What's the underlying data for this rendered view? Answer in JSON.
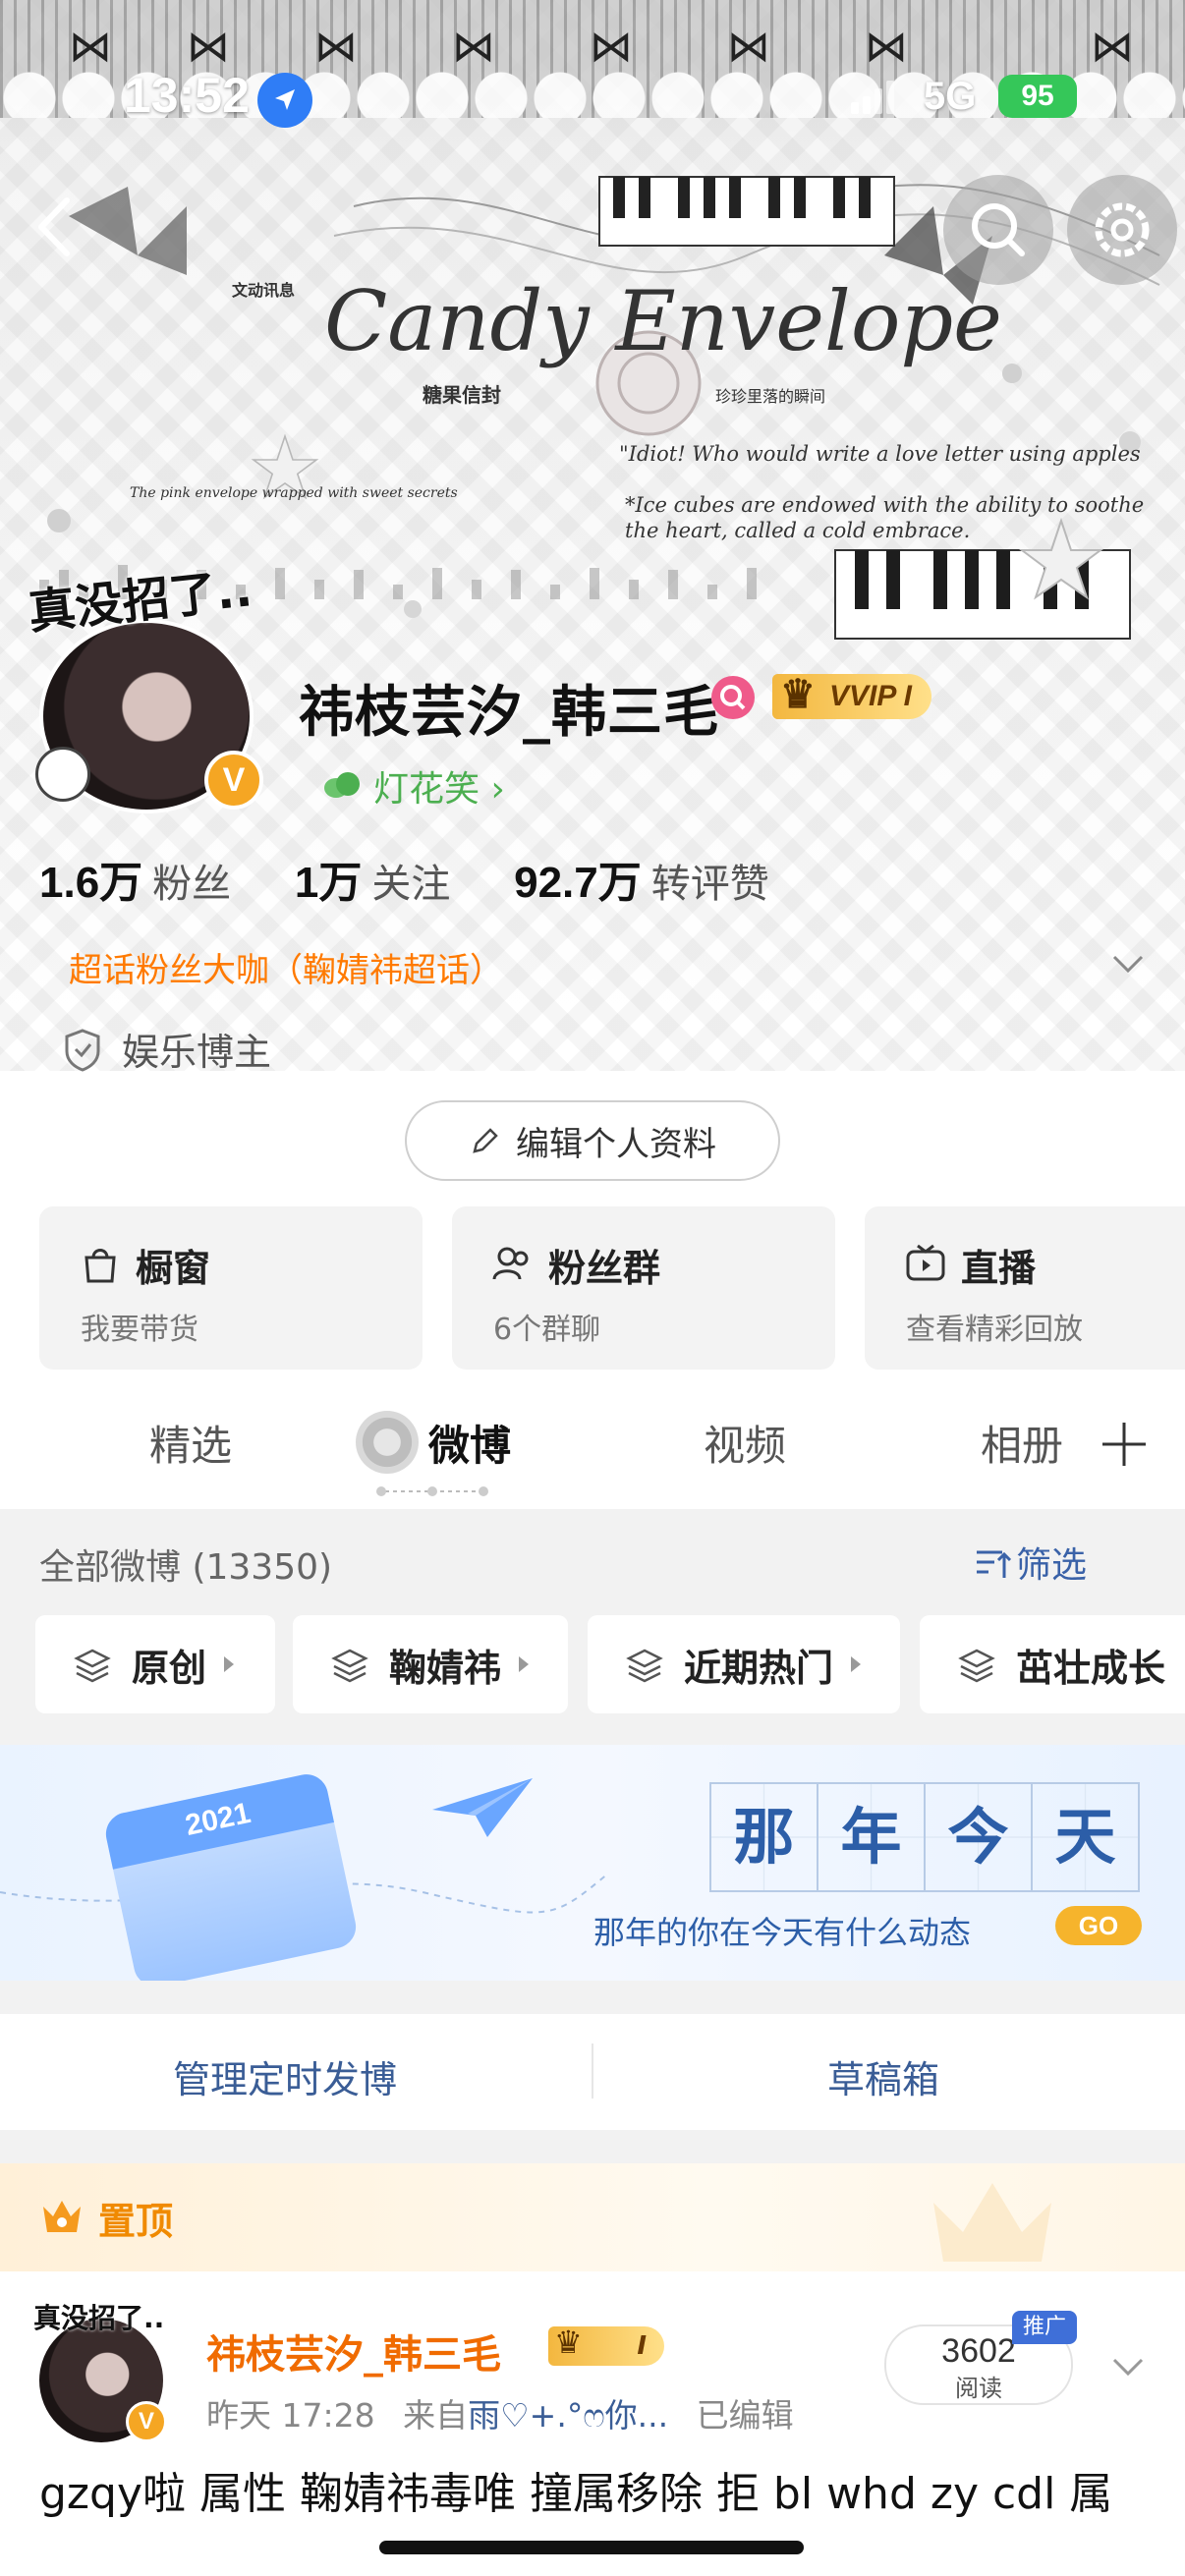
{
  "status_bar": {
    "time": "13:52",
    "network": "5G",
    "battery": "95"
  },
  "cover": {
    "art_title": "Candy Envelope",
    "art_cn_small": "糖果信封",
    "art_line1": "\"Idiot! Who would write a love letter using apples",
    "art_line2": "*Ice cubes are endowed with the ability to soothe",
    "art_line3": "the heart, called a cold embrace.",
    "art_sub": "The pink envelope wrapped with sweet secrets",
    "art_cn_top": "文动讯息",
    "art_cn_right": "珍珍里落的瞬间"
  },
  "profile": {
    "avatar_sticker": "真没招了..",
    "avatar_badge": "V",
    "username": "祎枝芸汐_韩三毛",
    "vip_label": "VVIP I",
    "lamp_text": "灯花笑 ›",
    "stats": [
      {
        "num": "1.6万",
        "label": "粉丝"
      },
      {
        "num": "1万",
        "label": "关注"
      },
      {
        "num": "92.7万",
        "label": "转评赞"
      }
    ],
    "super_tag": "超话粉丝大咖（鞠婧祎超话）",
    "blogger": "娱乐博主",
    "edit_label": "编辑个人资料"
  },
  "cards": [
    {
      "title": "橱窗",
      "sub": "我要带货"
    },
    {
      "title": "粉丝群",
      "sub": "6个群聊"
    },
    {
      "title": "直播",
      "sub": "查看精彩回放"
    }
  ],
  "tabs": [
    "精选",
    "微博",
    "视频",
    "相册"
  ],
  "filter": {
    "all_count": "全部微博 (13350)",
    "filter_label": "筛选",
    "chips": [
      "原创",
      "鞠婧祎",
      "近期热门",
      "茁壮成长"
    ]
  },
  "promo": {
    "calendar_year": "2021",
    "grid": [
      "那",
      "年",
      "今",
      "天"
    ],
    "text": "那年的你在今天有什么动态",
    "go": "GO"
  },
  "manage": {
    "scheduled": "管理定时发博",
    "drafts": "草稿箱"
  },
  "pinned": {
    "label": "置顶",
    "post": {
      "avatar_sticker": "真没招了..",
      "avatar_badge": "V",
      "author": "祎枝芸汐_韩三毛",
      "vip_label": "I",
      "time": "昨天 17:28",
      "from_prefix": "来自",
      "source": "雨♡+.°ෆ你...",
      "edited": "已编辑",
      "read_count": "3602",
      "read_label": "阅读",
      "promo_tag": "推广",
      "text": "gzqy啦 属性 鞠婧祎毒唯 撞属移除 拒 bl whd zy cdl 属"
    }
  },
  "colors": {
    "accent_orange": "#f06b00",
    "link_blue": "#3a5d96",
    "vip_gold": "#f3b73f",
    "battery_green": "#35c759"
  }
}
